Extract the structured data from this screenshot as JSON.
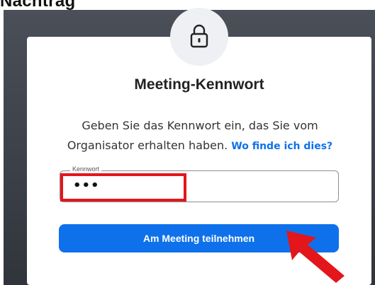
{
  "heading_fragment": "Nachtrag",
  "dialog": {
    "icon": "lock-icon",
    "title": "Meeting-Kennwort",
    "description_line1": "Geben Sie das Kennwort ein, das Sie vom",
    "description_line2": "Organisator erhalten haben.",
    "help_link": "Wo finde ich dies?",
    "password_field": {
      "label": "Kennwort",
      "value": "•••"
    },
    "join_button": "Am Meeting teilnehmen"
  },
  "annotations": {
    "highlight_color": "#e3161b",
    "arrow": "red-arrow-icon"
  },
  "colors": {
    "accent": "#0e71eb",
    "backdrop": "#3b3f47"
  }
}
